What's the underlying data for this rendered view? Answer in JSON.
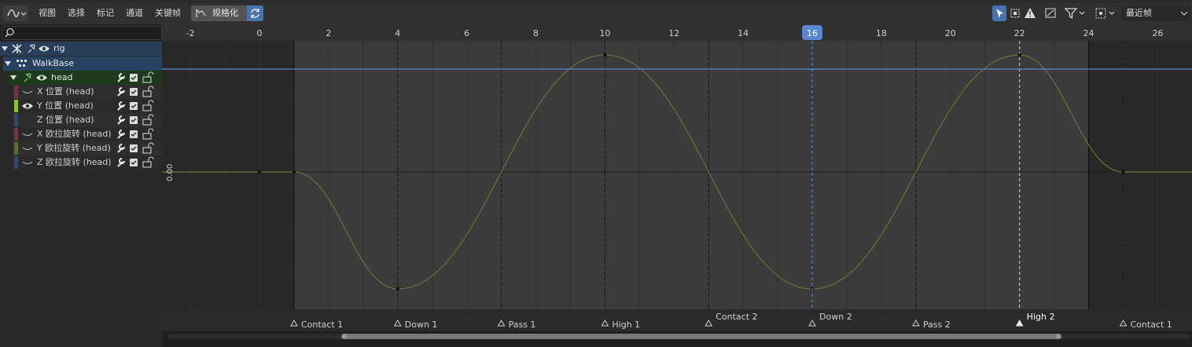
{
  "header": {
    "menus": [
      "视图",
      "选择",
      "标记",
      "通道",
      "关键帧"
    ],
    "normalize_label": "规格化",
    "snap_dropdown": "最近帧"
  },
  "channels": {
    "object": "rig",
    "action": "WalkBase",
    "group": "head",
    "fcurves": [
      {
        "label": "X 位置 (head)",
        "color": "#7a3640"
      },
      {
        "label": "Y 位置 (head)",
        "color": "#8ac814"
      },
      {
        "label": "Z 位置 (head)",
        "color": "#2d4a6e"
      },
      {
        "label": "X 欧拉旋转 (head)",
        "color": "#7a3640"
      },
      {
        "label": "Y 欧拉旋转 (head)",
        "color": "#5a6e2a"
      },
      {
        "label": "Z 欧拉旋转 (head)",
        "color": "#2d4a6e"
      }
    ]
  },
  "timeline": {
    "ticks": [
      "-2",
      "0",
      "2",
      "4",
      "6",
      "8",
      "10",
      "12",
      "14",
      "16",
      "18",
      "20",
      "22",
      "24",
      "26"
    ],
    "current_frame": "16",
    "value_label": "0.00",
    "markers": [
      {
        "frame": 1,
        "label": "Contact 1",
        "row": "low"
      },
      {
        "frame": 4,
        "label": "Down 1",
        "row": "low"
      },
      {
        "frame": 7,
        "label": "Pass 1",
        "row": "low"
      },
      {
        "frame": 10,
        "label": "High 1",
        "row": "low"
      },
      {
        "frame": 13,
        "label": "Contact 2",
        "row": "high"
      },
      {
        "frame": 16,
        "label": "Down 2",
        "row": "high"
      },
      {
        "frame": 19,
        "label": "Pass 2",
        "row": "low"
      },
      {
        "frame": 22,
        "label": "High 2",
        "row": "high",
        "selected": true
      },
      {
        "frame": 25,
        "label": "Contact 1",
        "row": "low"
      }
    ]
  },
  "chart_data": {
    "type": "line",
    "series": [
      {
        "values_x": [
          0,
          1,
          4,
          10,
          16,
          22,
          25
        ],
        "values_y": [
          0,
          0,
          -1,
          1,
          -1,
          1,
          0
        ]
      }
    ],
    "xlim": [
      -2.5,
      27
    ],
    "scene_range": [
      1,
      24
    ],
    "colors": {
      "curve": "#6b7136",
      "cursor": "#5a86d6"
    }
  }
}
